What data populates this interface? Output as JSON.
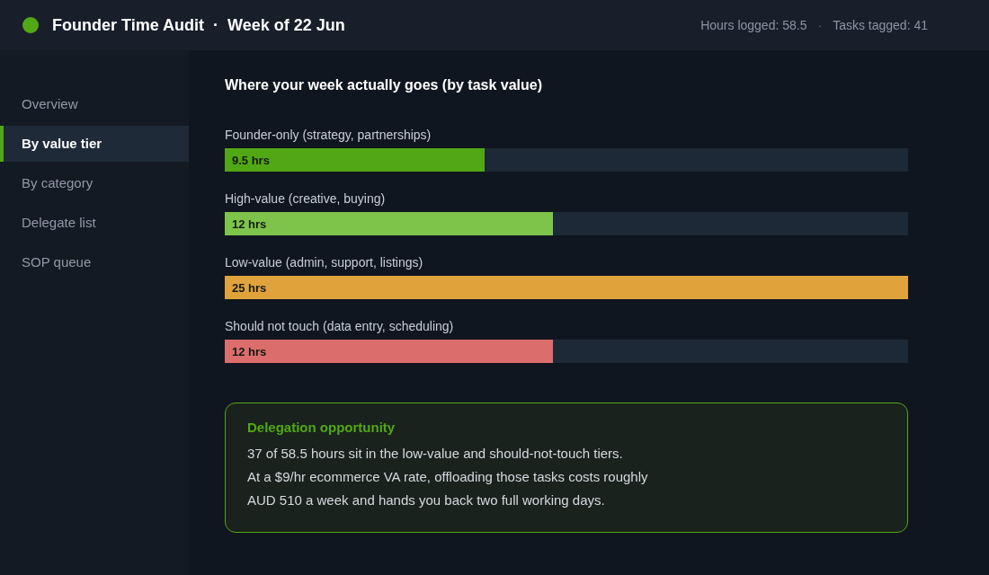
{
  "header": {
    "title": "Founder Time Audit",
    "separator": "·",
    "subtitle": "Week of 22 Jun",
    "stats": [
      {
        "text": "Hours logged: 58.5"
      },
      {
        "text": "Tasks tagged: 41"
      }
    ],
    "stats_separator": "·"
  },
  "sidebar": {
    "items": [
      {
        "label": "Overview",
        "selected": false
      },
      {
        "label": "By value tier",
        "selected": true
      },
      {
        "label": "By category",
        "selected": false
      },
      {
        "label": "Delegate list",
        "selected": false
      },
      {
        "label": "SOP queue",
        "selected": false
      }
    ]
  },
  "main": {
    "heading": "Where your week actually goes (by task value)",
    "tiers": [
      {
        "label": "Founder-only (strategy, partnerships)",
        "value": "9.5 hrs",
        "level": 0.38,
        "color": "#52a814"
      },
      {
        "label": "High-value (creative, buying)",
        "value": "12 hrs",
        "level": 0.48,
        "color": "#7ec44a"
      },
      {
        "label": "Low-value (admin, support, listings)",
        "value": "25 hrs",
        "level": 1.0,
        "color": "#e0a23a"
      },
      {
        "label": "Should not touch (data entry, scheduling)",
        "value": "12 hrs",
        "level": 0.48,
        "color": "#dc6d6d"
      }
    ],
    "callout": {
      "title": "Delegation opportunity",
      "lines": [
        "37 of 58.5 hours sit in the low-value and should-not-touch tiers.",
        "At a $9/hr ecommerce VA rate, offloading those tasks costs roughly",
        "AUD 510 a week and hands you back two full working days."
      ]
    }
  }
}
